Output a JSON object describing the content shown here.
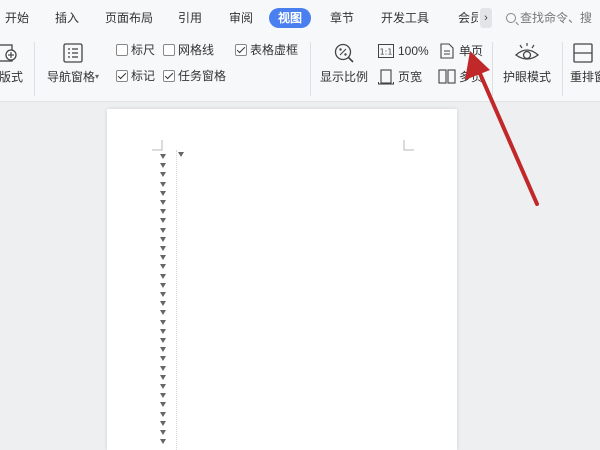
{
  "tabs": [
    {
      "label": "开始",
      "active": false
    },
    {
      "label": "插入",
      "active": false
    },
    {
      "label": "页面布局",
      "active": false
    },
    {
      "label": "引用",
      "active": false
    },
    {
      "label": "审阅",
      "active": false
    },
    {
      "label": "视图",
      "active": true
    },
    {
      "label": "章节",
      "active": false
    },
    {
      "label": "开发工具",
      "active": false
    },
    {
      "label": "会员",
      "active": false
    }
  ],
  "tab_more_icon": "chevron-right-icon",
  "search": {
    "text": "查找命令、搜",
    "icon": "search-icon"
  },
  "ribbon": {
    "layout_label": "版式",
    "nav_pane_label": "导航窗格",
    "checks": {
      "ruler": {
        "label": "标尺",
        "checked": false
      },
      "gridlines": {
        "label": "网格线",
        "checked": false
      },
      "table_dashed": {
        "label": "表格虚框",
        "checked": true
      },
      "marks": {
        "label": "标记",
        "checked": true
      },
      "task_pane": {
        "label": "任务窗格",
        "checked": true
      }
    },
    "zoom_label": "显示比例",
    "zoom_100_label": "100%",
    "page_width_label": "页宽",
    "single_page_label": "单页",
    "multi_page_label": "多页",
    "eye_mode_label": "护眼模式",
    "rearrange_label": "重排窗"
  },
  "colors": {
    "accent": "#4a7ff0",
    "arrow": "#c0282a",
    "canvas": "#eeeff1"
  }
}
